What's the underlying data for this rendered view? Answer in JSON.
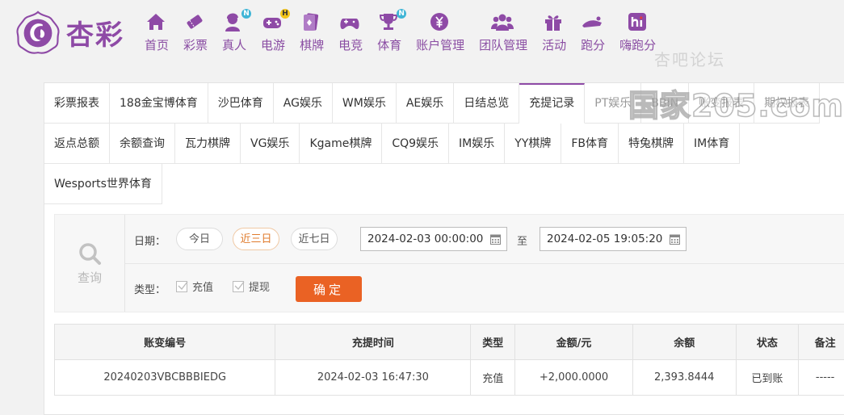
{
  "brand": {
    "name": "杏彩",
    "primary_color": "#8e4aa6",
    "accent_color": "#ea6224"
  },
  "nav": [
    {
      "label": "首页",
      "icon": "home-icon",
      "badge": ""
    },
    {
      "label": "彩票",
      "icon": "lottery-ticket-icon",
      "badge": ""
    },
    {
      "label": "真人",
      "icon": "live-dealer-icon",
      "badge": "N"
    },
    {
      "label": "电游",
      "icon": "gamepad-icon",
      "badge": "H"
    },
    {
      "label": "棋牌",
      "icon": "cards-icon",
      "badge": ""
    },
    {
      "label": "电竞",
      "icon": "controller-icon",
      "badge": ""
    },
    {
      "label": "体育",
      "icon": "trophy-icon",
      "badge": "N"
    },
    {
      "label": "账户管理",
      "icon": "yen-coin-icon",
      "badge": ""
    },
    {
      "label": "团队管理",
      "icon": "team-icon",
      "badge": ""
    },
    {
      "label": "活动",
      "icon": "gift-icon",
      "badge": ""
    },
    {
      "label": "跑分",
      "icon": "running-icon",
      "badge": ""
    },
    {
      "label": "嗨跑分",
      "icon": "hi-app-icon",
      "badge": ""
    }
  ],
  "watermark": {
    "text_top": "杏吧论坛",
    "text_big": "国家205.com"
  },
  "tabs": {
    "row1": [
      "彩票报表",
      "188金宝博体育",
      "沙巴体育",
      "AG娱乐",
      "WM娱乐",
      "AE娱乐",
      "日结总览",
      "充提记录",
      "PT娱乐",
      "BBIN",
      "账变报表",
      "期权报表"
    ],
    "row2": [
      "返点总额",
      "余额查询",
      "瓦力棋牌",
      "VG娱乐",
      "Kgame棋牌",
      "CQ9娱乐",
      "IM娱乐",
      "YY棋牌",
      "FB体育",
      "特兔棋牌",
      "IM体育"
    ],
    "row3": [
      "Wesports世界体育"
    ],
    "active": "充提记录"
  },
  "query": {
    "label": "查询",
    "date_label": "日期：",
    "quick_ranges": [
      "今日",
      "近三日",
      "近七日"
    ],
    "active_range": "近三日",
    "start_date": "2024-02-03 00:00:00",
    "to_label": "至",
    "end_date": "2024-02-05 19:05:20",
    "type_label": "类型：",
    "type_options": [
      {
        "label": "充值",
        "checked": true
      },
      {
        "label": "提现",
        "checked": true
      }
    ],
    "confirm_label": "确定"
  },
  "table": {
    "headers": [
      "账变编号",
      "充提时间",
      "类型",
      "金额/元",
      "余额",
      "状态",
      "备注"
    ],
    "rows": [
      [
        "20240203VBCBBBIEDG",
        "2024-02-03 16:47:30",
        "充值",
        "+2,000.0000",
        "2,393.8444",
        "已到账",
        "-----"
      ]
    ]
  }
}
